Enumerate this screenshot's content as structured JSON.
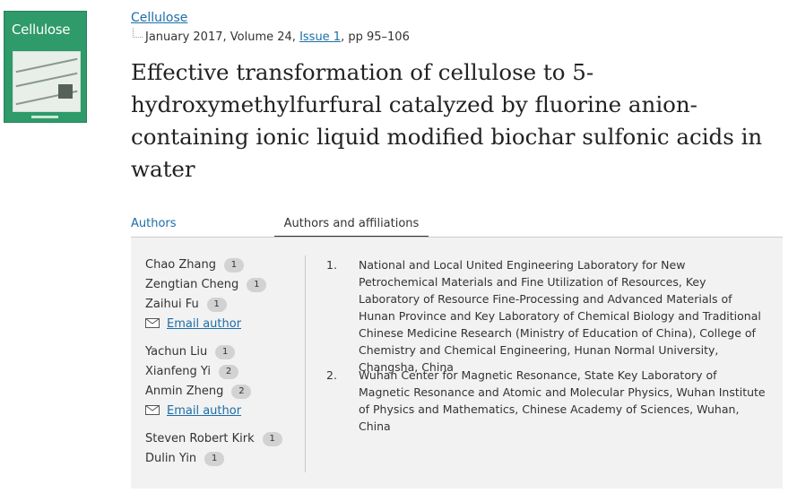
{
  "journal": {
    "name": "Cellulose",
    "cover_title": "Cellulose",
    "meta_prefix": "January 2017, Volume 24, ",
    "issue": "Issue 1",
    "meta_suffix": ", pp 95–106"
  },
  "article": {
    "title": "Effective transformation of cellulose to 5-hydroxymethylfurfural catalyzed by fluorine anion-containing ionic liquid modified biochar sulfonic acids in water"
  },
  "tabs": {
    "authors": "Authors",
    "affiliations": "Authors and affiliations"
  },
  "authors": [
    {
      "name": "Chao Zhang",
      "affil": "1"
    },
    {
      "name": "Zengtian Cheng",
      "affil": "1"
    },
    {
      "name": "Zaihui Fu",
      "affil": "1"
    },
    {
      "name": "Yachun Liu",
      "affil": "1"
    },
    {
      "name": "Xianfeng Yi",
      "affil": "2"
    },
    {
      "name": "Anmin Zheng",
      "affil": "2"
    },
    {
      "name": "Steven Robert Kirk",
      "affil": "1"
    },
    {
      "name": "Dulin Yin",
      "affil": "1"
    }
  ],
  "email_label": "Email author",
  "affiliations": [
    {
      "number": "1.",
      "text": "National and Local United Engineering Laboratory for New Petrochemical Materials and Fine Utilization of Resources, Key Laboratory of Resource Fine-Processing and Advanced Materials of Hunan Province and Key Laboratory of Chemical Biology and Traditional Chinese Medicine Research (Ministry of Education of China), College of Chemistry and Chemical Engineering, Hunan Normal University, Changsha, China"
    },
    {
      "number": "2.",
      "text": "Wuhan Center for Magnetic Resonance, State Key Laboratory of Magnetic Resonance and Atomic and Molecular Physics, Wuhan Institute of Physics and Mathematics, Chinese Academy of Sciences, Wuhan, China"
    }
  ],
  "colors": {
    "link": "#1b6ea8",
    "cover": "#2f9a6a",
    "panel": "#f2f2f2",
    "badge": "#d2d2d2"
  }
}
